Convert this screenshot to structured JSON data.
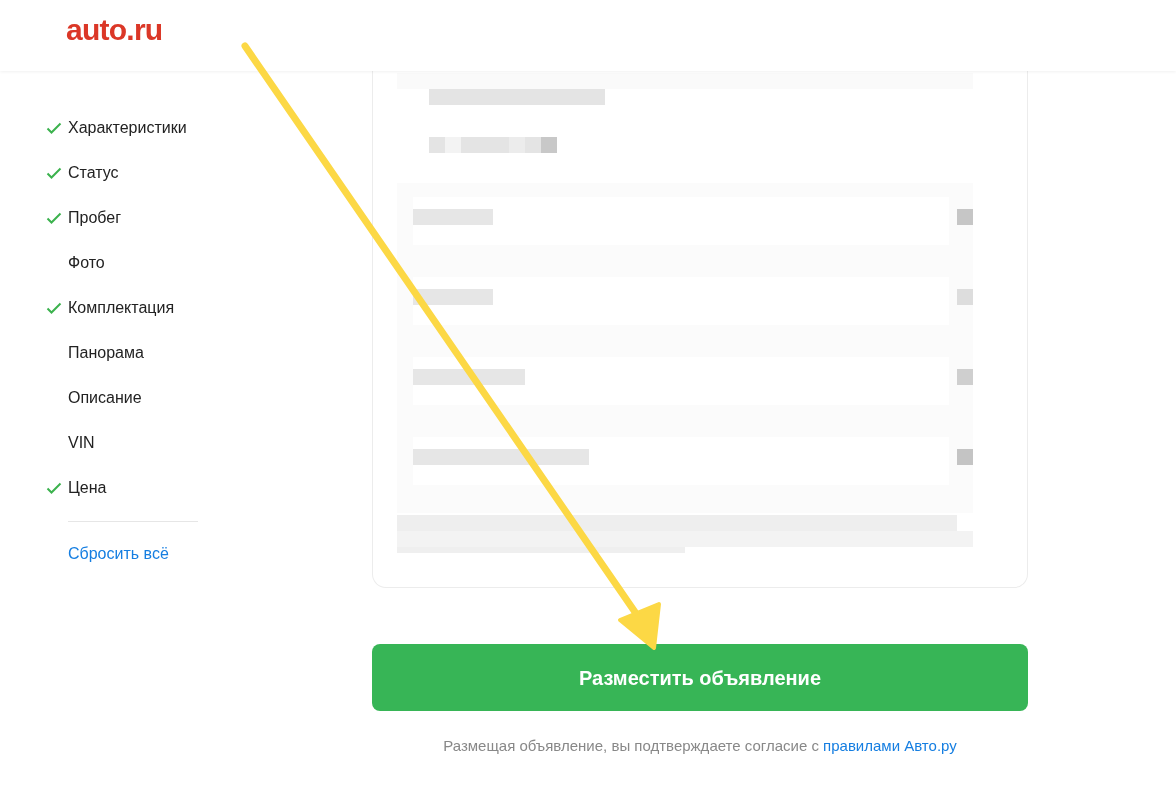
{
  "header": {
    "logo": "auto.ru"
  },
  "sidebar": {
    "items": [
      {
        "label": "Характеристики",
        "done": true
      },
      {
        "label": "Статус",
        "done": true
      },
      {
        "label": "Пробег",
        "done": true
      },
      {
        "label": "Фото",
        "done": false
      },
      {
        "label": "Комплектация",
        "done": true
      },
      {
        "label": "Панорама",
        "done": false
      },
      {
        "label": "Описание",
        "done": false
      },
      {
        "label": "VIN",
        "done": false
      },
      {
        "label": "Цена",
        "done": true
      }
    ],
    "reset_link": "Сбросить всё"
  },
  "submit_button": "Разместить объявление",
  "consent": {
    "text": "Размещая объявление, вы подтверждаете согласие с",
    "link": "правилами Авто.ру"
  }
}
